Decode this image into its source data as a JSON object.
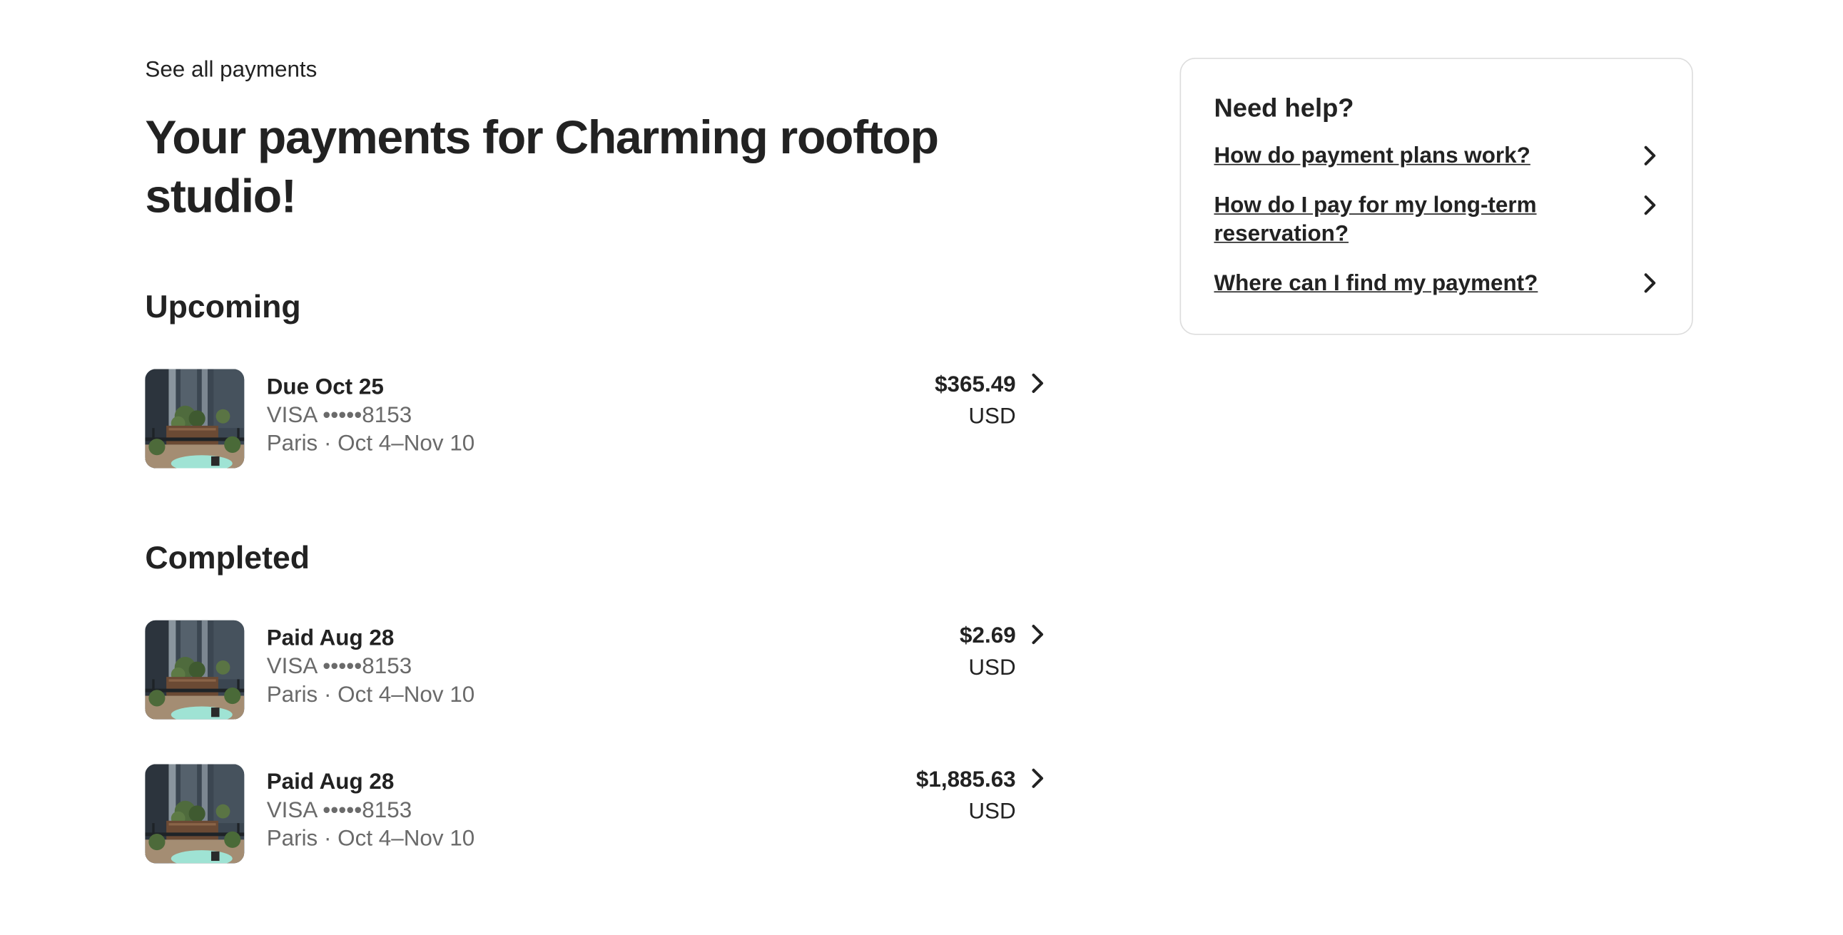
{
  "nav": {
    "back_label": "See all payments"
  },
  "page": {
    "title": "Your payments for Charming rooftop studio!"
  },
  "sections": {
    "upcoming": {
      "title": "Upcoming",
      "items": [
        {
          "status": "Due Oct 25",
          "card": "VISA •••••8153",
          "trip": "Paris · Oct 4–Nov 10",
          "amount": "$365.49",
          "currency": "USD"
        }
      ]
    },
    "completed": {
      "title": "Completed",
      "items": [
        {
          "status": "Paid Aug 28",
          "card": "VISA •••••8153",
          "trip": "Paris · Oct 4–Nov 10",
          "amount": "$2.69",
          "currency": "USD"
        },
        {
          "status": "Paid Aug 28",
          "card": "VISA •••••8153",
          "trip": "Paris · Oct 4–Nov 10",
          "amount": "$1,885.63",
          "currency": "USD"
        }
      ]
    }
  },
  "help": {
    "title": "Need help?",
    "links": [
      {
        "label": "How do payment plans work?"
      },
      {
        "label": "How do I pay for my long-term reservation?"
      },
      {
        "label": "Where can I find my payment?"
      }
    ]
  },
  "icons": {
    "row_chevron": "chevron-right-icon",
    "listing_photo": "listing-thumbnail"
  },
  "colors": {
    "text_primary": "#222222",
    "text_secondary": "#6a6a6a",
    "card_border": "#dddddd"
  }
}
